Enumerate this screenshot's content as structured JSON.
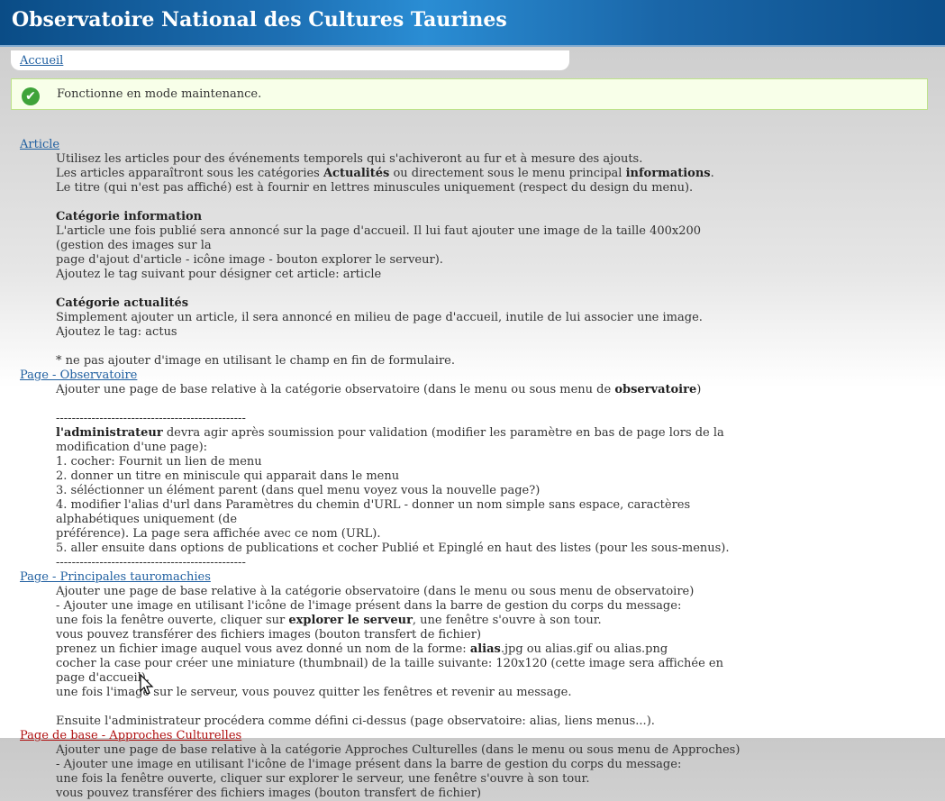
{
  "header": {
    "title": "Observatoire National des Cultures Taurines"
  },
  "breadcrumb": {
    "home": "Accueil"
  },
  "message": {
    "text": "Fonctionne en mode maintenance.",
    "icon": "check-circle-icon"
  },
  "sections": {
    "article": {
      "title": "Article",
      "l1": "Utilisez les articles pour des événements temporels qui s'achiveront au fur et à mesure des ajouts.",
      "l2a": "Les articles apparaîtront sous les catégories ",
      "l2b": "Actualités",
      "l2c": " ou directement sous le menu principal ",
      "l2d": "informations",
      "l2e": ".",
      "l3": "Le titre (qui n'est pas affiché) est à fournir en lettres minuscules uniquement (respect du design du menu).",
      "info_head": "Catégorie information",
      "info1": "L'article une fois publié sera annoncé sur la page d'accueil. Il lui faut ajouter une image de la taille 400x200 (gestion des images sur la",
      "info2": "page d'ajout d'article - icône image - bouton explorer le serveur).",
      "info3": "Ajoutez le tag suivant pour désigner cet article: article",
      "act_head": "Catégorie actualités",
      "act1": "Simplement ajouter un article, il sera annoncé en milieu de page d'accueil, inutile de lui associer une image.",
      "act2": "Ajoutez le tag: actus",
      "note": "* ne pas ajouter d'image en utilisant le champ en fin de formulaire."
    },
    "observatoire": {
      "title": "Page - Observatoire",
      "l1a": "Ajouter une page de base relative à la catégorie observatoire (dans le menu ou sous menu de ",
      "l1b": "observatoire",
      "l1c": ")",
      "sep": "------------------------------------------------",
      "admin_a": "l'administrateur",
      "admin_b": " devra agir après soumission pour validation (modifier les paramètre en bas de page lors de la modification d'une page):",
      "s1": "1. cocher: Fournit un lien de menu",
      "s2": "2. donner un titre en miniscule qui apparait dans le menu",
      "s3": "3. séléctionner un élément parent (dans quel menu voyez vous la nouvelle page?)",
      "s4a": "4. modifier l'alias d'url dans Paramètres du chemin d'URL - donner un nom simple sans espace, caractères alphabétiques uniquement (de",
      "s4b": "préférence). La page sera affichée avec ce nom (URL).",
      "s5": "5. aller ensuite dans options de publications et cocher Publié et Epinglé en haut des listes (pour les sous-menus).",
      "sep2": "------------------------------------------------"
    },
    "tauromachies": {
      "title": "Page - Principales tauromachies",
      "l1": "Ajouter une page de base relative à la catégorie observatoire (dans le menu ou sous menu de observatoire)",
      "l2": "- Ajouter une image en utilisant l'icône de l'image présent dans la barre de gestion du corps du message:",
      "l3a": "une fois la fenêtre ouverte, cliquer sur ",
      "l3b": "explorer le serveur",
      "l3c": ", une fenêtre s'ouvre à son tour.",
      "l4": "vous pouvez transférer des fichiers images (bouton transfert de fichier)",
      "l5a": "prenez un fichier image auquel vous avez donné un nom de la forme: ",
      "l5b": "alias",
      "l5c": ".jpg ou alias.gif ou alias.png",
      "l6": "cocher la case pour créer une miniature (thumbnail) de la taille suivante: 120x120 (cette image sera affichée en page d'accueil).",
      "l7": "une fois l'image sur le serveur, vous pouvez quitter les fenêtres et revenir au message.",
      "l8": "Ensuite l'administrateur procédera comme défini ci-dessus (page observatoire: alias, liens menus...)."
    },
    "approches": {
      "title": "Page de base - Approches Culturelles",
      "l1": "Ajouter une page de base relative à la catégorie Approches Culturelles (dans le menu ou sous menu de Approches)",
      "l2": "- Ajouter une image en utilisant l'icône de l'image présent dans la barre de gestion du corps du message:",
      "l3": "une fois la fenêtre ouverte, cliquer sur explorer le serveur, une fenêtre s'ouvre à son tour.",
      "l4": "vous pouvez transférer des fichiers images (bouton transfert de fichier)"
    }
  }
}
